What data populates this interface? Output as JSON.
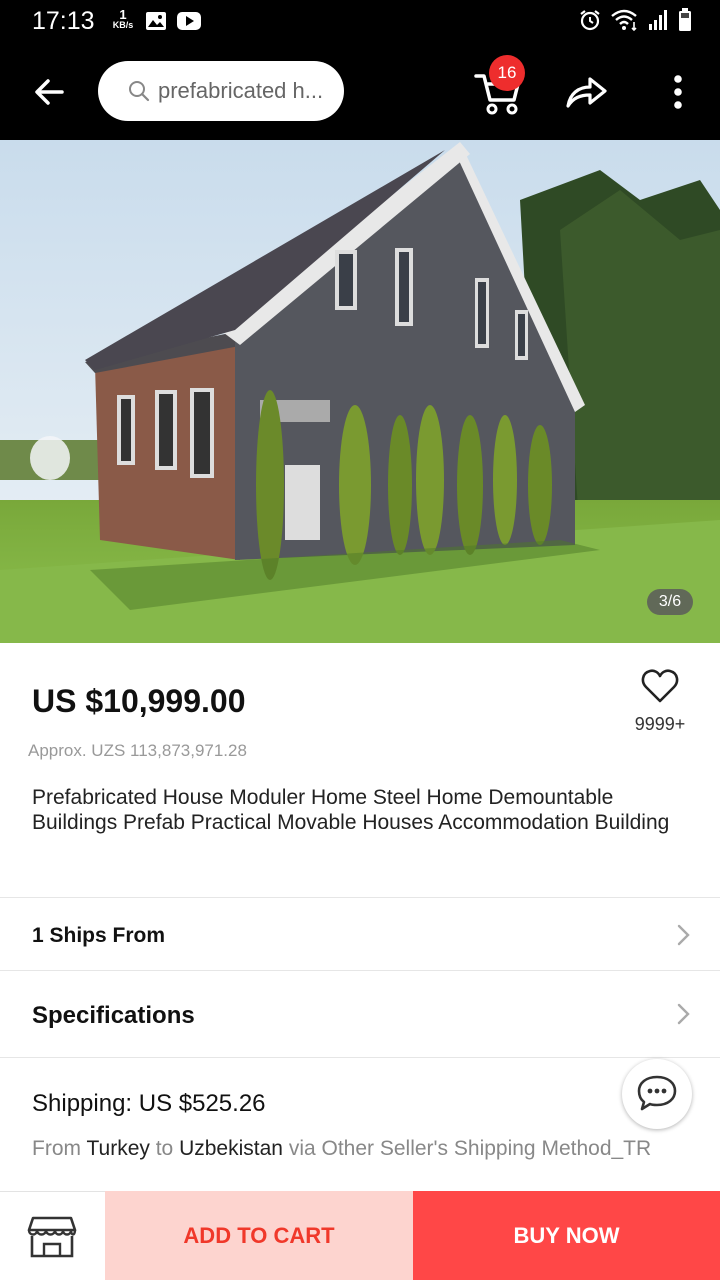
{
  "status_bar": {
    "time": "17:13",
    "net_speed_value": "1",
    "net_speed_unit": "KB/s",
    "left_icons": [
      "gallery-icon",
      "youtube-icon"
    ],
    "right_icons": [
      "alarm-icon",
      "wifi-icon",
      "signal-icon",
      "battery-icon"
    ]
  },
  "app_bar": {
    "search_text": "prefabricated h...",
    "cart_badge": "16",
    "icons": [
      "back-arrow-icon",
      "search-icon",
      "cart-icon",
      "share-icon",
      "more-vertical-icon"
    ]
  },
  "gallery": {
    "counter": "3/6"
  },
  "product": {
    "price": "US $10,999.00",
    "approx_price": "Approx. UZS 113,873,971.28",
    "wishlist_count": "9999+",
    "title": "Prefabricated House Moduler Home Steel Home Demountable Buildings Prefab Practical Movable Houses Accommodation Building"
  },
  "rows": {
    "ships_from": "1 Ships From",
    "specifications": "Specifications"
  },
  "shipping": {
    "price_text": "Shipping: US $525.26",
    "from_word": "From",
    "origin": "Turkey",
    "to_word": "to",
    "destination": "Uzbekistan",
    "method_text": "via Other Seller's Shipping Method_TR"
  },
  "bottom_bar": {
    "add_to_cart": "ADD TO CART",
    "buy_now": "BUY NOW"
  },
  "colors": {
    "accent_red": "#ff4747",
    "add_cart_bg": "#fdd4cf",
    "add_cart_text": "#f0382a",
    "badge_red": "#ee2d2d"
  }
}
